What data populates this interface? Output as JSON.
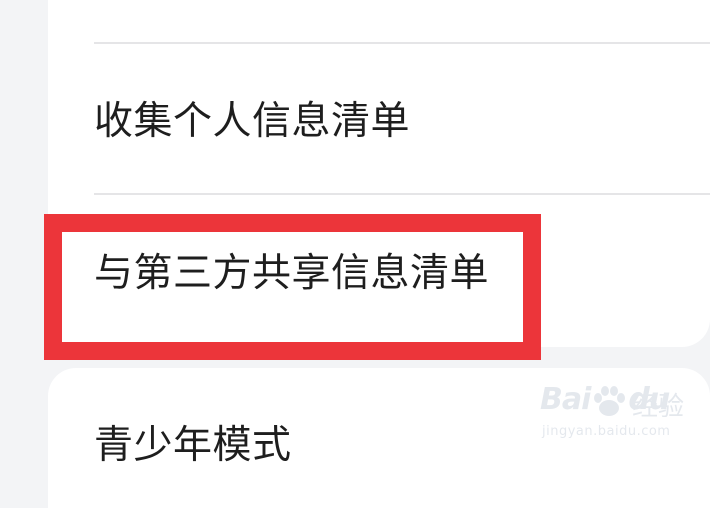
{
  "settings_list": {
    "items": [
      {
        "label": "收集个人信息清单"
      },
      {
        "label": "与第三方共享信息清单"
      },
      {
        "label": "青少年模式"
      }
    ]
  },
  "annotation": {
    "highlight_color": "#ec353a"
  },
  "watermark": {
    "brand": "Bai",
    "brand_end": "du",
    "sub": "经验",
    "url": "jingyan.baidu.com"
  }
}
